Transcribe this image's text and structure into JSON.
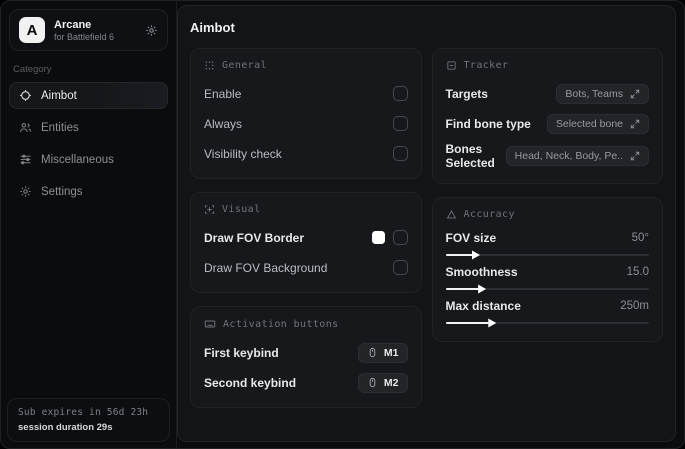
{
  "app": {
    "logo_letter": "A",
    "name": "Arcane",
    "subtitle": "for Battlefield 6",
    "action_icon": "gear-icon"
  },
  "sidebar": {
    "category_label": "Category",
    "items": [
      {
        "label": "Aimbot",
        "icon": "crosshair-icon",
        "selected": true
      },
      {
        "label": "Entities",
        "icon": "users-icon",
        "selected": false
      },
      {
        "label": "Miscellaneous",
        "icon": "sliders-icon",
        "selected": false
      },
      {
        "label": "Settings",
        "icon": "gear-icon",
        "selected": false
      }
    ],
    "footer": {
      "line1": "Sub expires in 56d 23h",
      "line2": "session duration 29s"
    }
  },
  "main": {
    "title": "Aimbot",
    "cards": {
      "general": {
        "title": "General",
        "icon": "grid-dots-icon",
        "rows": [
          {
            "label": "Enable",
            "control": "checkbox",
            "checked": false
          },
          {
            "label": "Always",
            "control": "checkbox",
            "checked": false
          },
          {
            "label": "Visibility check",
            "control": "checkbox",
            "checked": false
          }
        ]
      },
      "visual": {
        "title": "Visual",
        "icon": "frame-plus-icon",
        "rows": [
          {
            "label": "Draw FOV Border",
            "control": "color+checkbox",
            "swatch": "#ffffff",
            "checked": false
          },
          {
            "label": "Draw FOV Background",
            "control": "checkbox",
            "checked": false
          }
        ]
      },
      "activation": {
        "title": "Activation buttons",
        "icon": "keyboard-icon",
        "rows": [
          {
            "label": "First keybind",
            "key": "M1",
            "key_icon": "mouse-icon"
          },
          {
            "label": "Second keybind",
            "key": "M2",
            "key_icon": "mouse-icon"
          }
        ]
      },
      "tracker": {
        "title": "Tracker",
        "icon": "minus-square-icon",
        "rows": [
          {
            "label": "Targets",
            "value": "Bots, Teams",
            "icon": "expand-icon"
          },
          {
            "label": "Find bone type",
            "value": "Selected bone",
            "icon": "expand-icon"
          },
          {
            "label": "Bones Selected",
            "value": "Head, Neck, Body, Pe..",
            "icon": "expand-icon"
          }
        ]
      },
      "accuracy": {
        "title": "Accuracy",
        "icon": "triangle-icon",
        "sliders": [
          {
            "label": "FOV size",
            "value": "50°",
            "fraction": 0.14
          },
          {
            "label": "Smoothness",
            "value": "15.0",
            "fraction": 0.17
          },
          {
            "label": "Max distance",
            "value": "250m",
            "fraction": 0.22
          }
        ]
      }
    }
  },
  "colors": {
    "window_bg": "#0b0c0e",
    "main_bg": "#131418",
    "card_bg": "#17181c",
    "card_border": "#212226",
    "accent_swatch": "#ffffff",
    "text_primary": "#e6e8ea",
    "text_muted": "#8b8e94"
  }
}
